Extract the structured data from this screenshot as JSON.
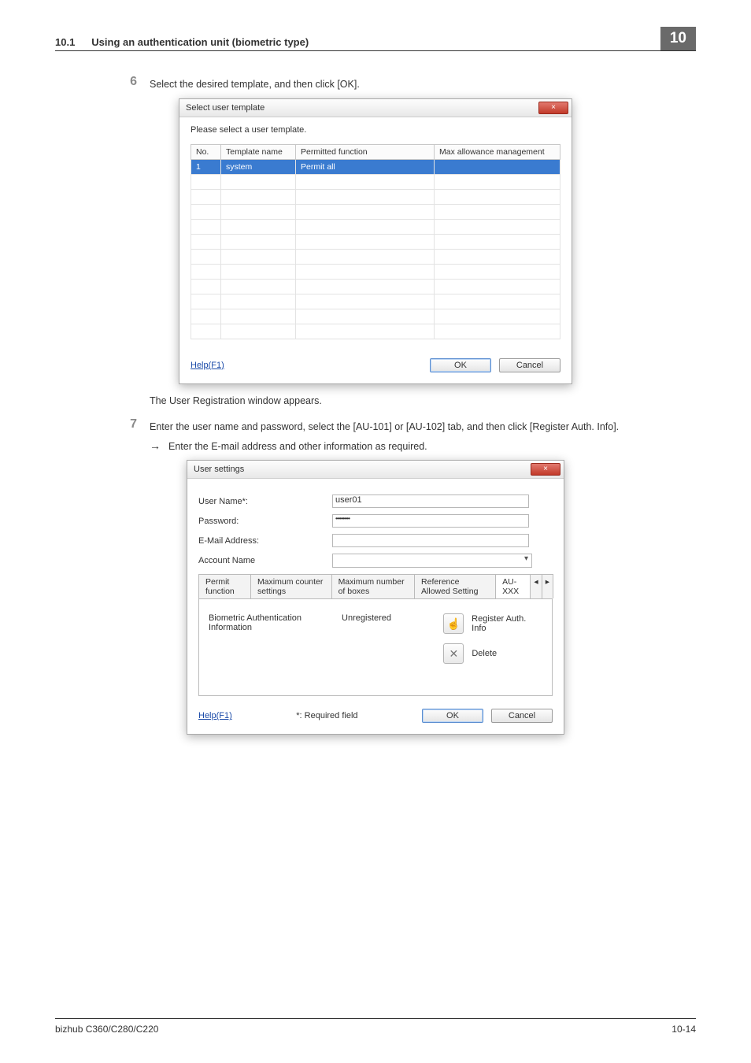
{
  "header": {
    "section_number": "10.1",
    "section_title": "Using an authentication unit (biometric type)",
    "chapter": "10"
  },
  "steps": {
    "s6": {
      "num": "6",
      "text": "Select the desired template, and then click [OK]."
    },
    "s6_after": "The User Registration window appears.",
    "s7": {
      "num": "7",
      "text": "Enter the user name and password, select the [AU-101] or [AU-102] tab, and then click [Register Auth. Info]."
    },
    "s7_sub": "Enter the E-mail address and other information as required."
  },
  "dialog1": {
    "title": "Select user template",
    "close": "×",
    "instruction": "Please select a user template.",
    "cols": {
      "c1": "No.",
      "c2": "Template name",
      "c3": "Permitted function",
      "c4": "Max allowance management"
    },
    "row1": {
      "no": "1",
      "name": "system",
      "func": "Permit all",
      "max": ""
    },
    "help": "Help(F1)",
    "ok": "OK",
    "cancel": "Cancel"
  },
  "dialog2": {
    "title": "User settings",
    "close": "×",
    "labels": {
      "username": "User Name*:",
      "password": "Password:",
      "email": "E-Mail Address:",
      "account": "Account Name"
    },
    "values": {
      "username": "user01",
      "password": "••••••••••"
    },
    "tabs": {
      "t1": "Permit function",
      "t2": "Maximum counter settings",
      "t3": "Maximum number of boxes",
      "t4": "Reference Allowed Setting",
      "t5": "AU-XXX",
      "t6": "◂",
      "t7": "▸"
    },
    "pane": {
      "label": "Biometric Authentication Information",
      "value": "Unregistered",
      "register": "Register Auth. Info",
      "delete": "Delete"
    },
    "help": "Help(F1)",
    "required": "*: Required field",
    "ok": "OK",
    "cancel": "Cancel"
  },
  "footer": {
    "left": "bizhub C360/C280/C220",
    "right": "10-14"
  }
}
